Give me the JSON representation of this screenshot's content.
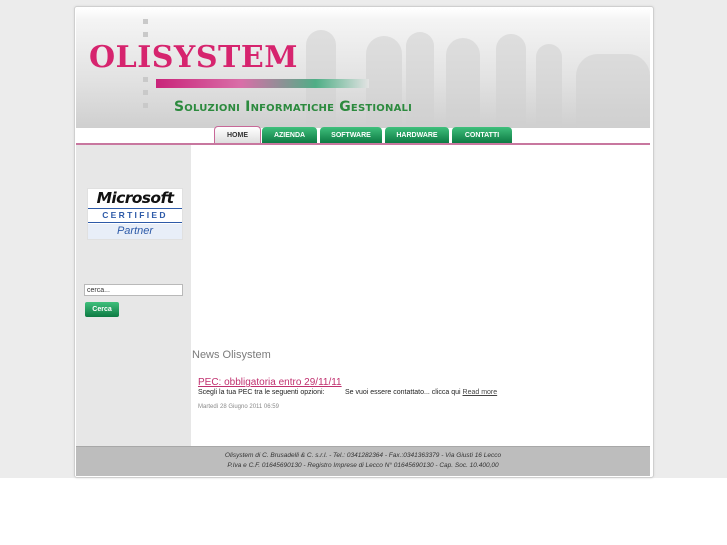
{
  "header": {
    "logo_text": "OLISYSTEM",
    "subtitle": "Soluzioni Informatiche Gestionali"
  },
  "nav": {
    "tabs": [
      {
        "label": "HOME",
        "active": true
      },
      {
        "label": "AZIENDA",
        "active": false
      },
      {
        "label": "SOFTWARE",
        "active": false
      },
      {
        "label": "HARDWARE",
        "active": false
      },
      {
        "label": "CONTATTI",
        "active": false
      }
    ]
  },
  "sidebar": {
    "badge": {
      "brand": "Microsoft",
      "certified": "CERTIFIED",
      "partner": "Partner"
    },
    "search": {
      "value": "cerca...",
      "button_label": "Cerca"
    }
  },
  "news": {
    "heading": "News Olisystem",
    "article": {
      "title": "PEC: obbligatoria entro 29/11/11",
      "text_left": "Scegli la tua PEC tra le seguenti opzioni:",
      "text_right": "Se vuoi essere contattato... clicca qui",
      "read_more": "Read more",
      "date": "Martedì 28 Giugno 2011 06:59"
    }
  },
  "footer": {
    "line1": "Olisystem di C. Brusadelli & C. s.r.l.  -  Tel.: 0341282364  -  Fax.:0341363379  -  Via Giusti 16 Lecco",
    "line2": "P.Iva e C.F. 01645690130  -  Registro Imprese di Lecco N° 01645690130  -  Cap. Soc. 10.400,00"
  },
  "colors": {
    "brand_pink": "#d6246e",
    "brand_green": "#2c8a3e",
    "nav_green": "#0d7a43"
  }
}
